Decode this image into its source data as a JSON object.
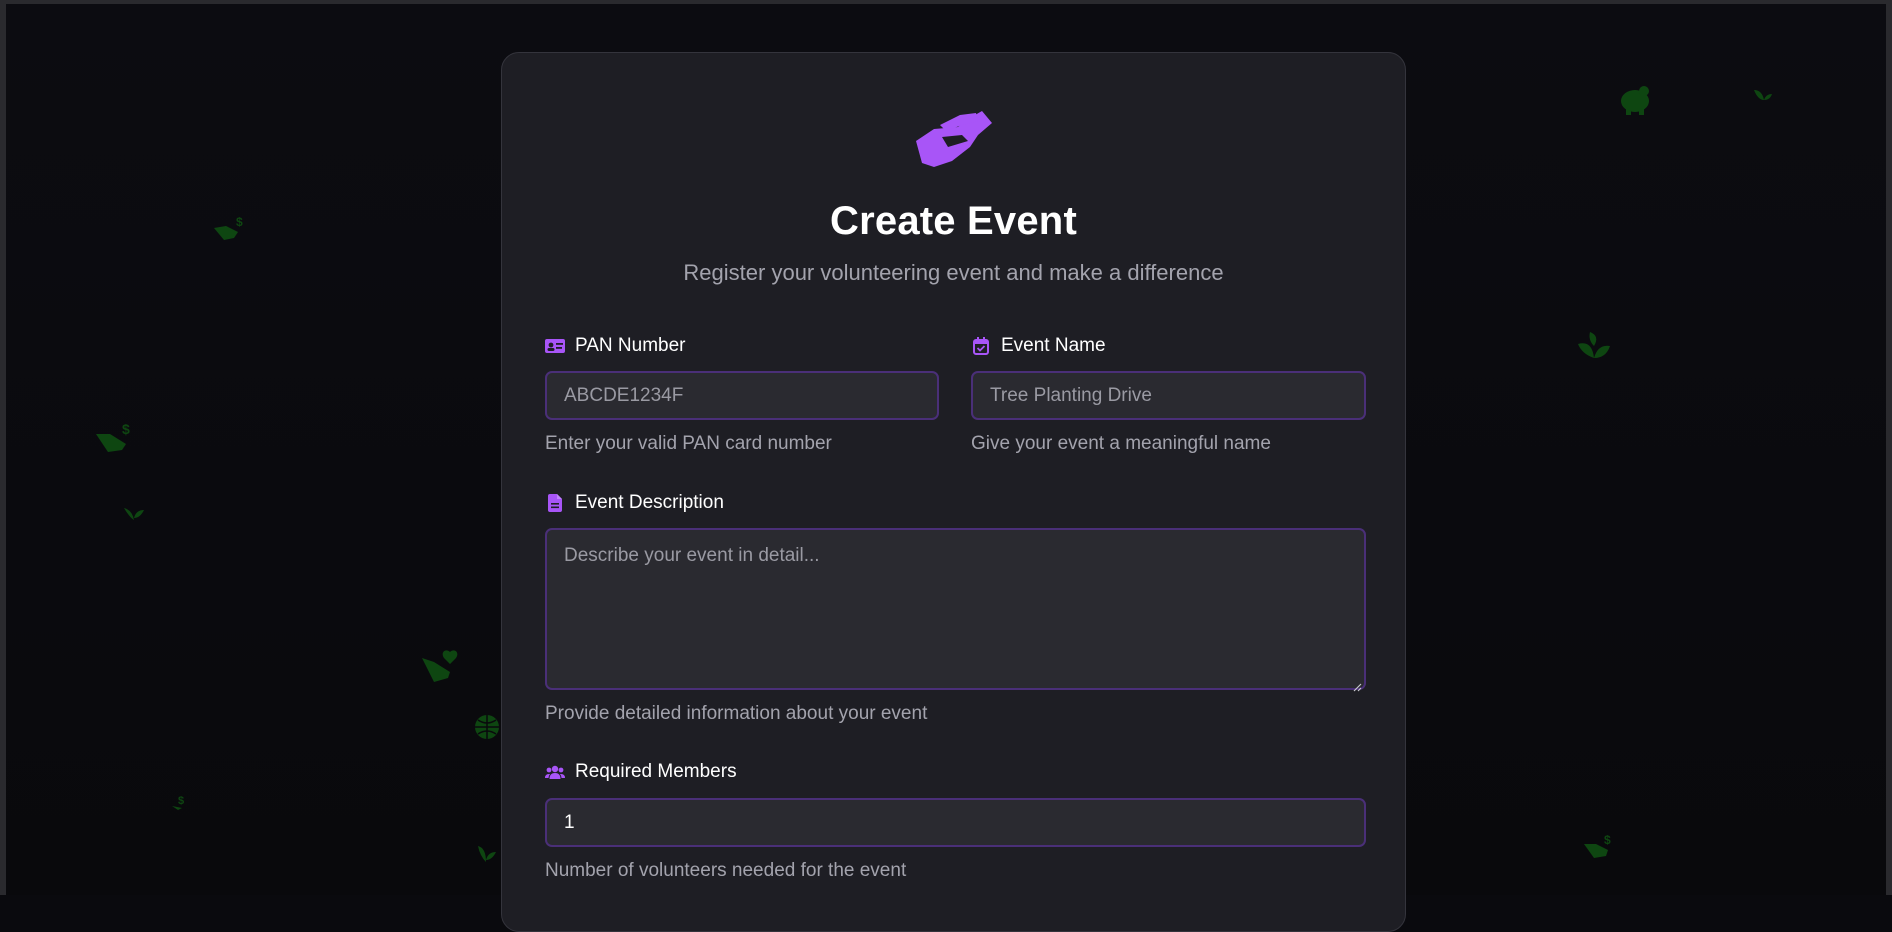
{
  "page": {
    "title": "Create Event",
    "subtitle": "Register your volunteering event and make a difference",
    "logo_icon": "handshake-icon",
    "accent_color": "#a855f7",
    "background_color": "#0a0a0e",
    "card_color": "#1e1e24",
    "deco_color": "#0f4d12"
  },
  "form": {
    "pan": {
      "label": "PAN Number",
      "icon": "id-card-icon",
      "placeholder": "ABCDE1234F",
      "hint": "Enter your valid PAN card number"
    },
    "event_name": {
      "label": "Event Name",
      "icon": "calendar-check-icon",
      "placeholder": "Tree Planting Drive",
      "hint": "Give your event a meaningful name"
    },
    "description": {
      "label": "Event Description",
      "icon": "file-text-icon",
      "placeholder": "Describe your event in detail...",
      "hint": "Provide detailed information about your event"
    },
    "members": {
      "label": "Required Members",
      "icon": "users-icon",
      "value": "1",
      "hint": "Number of volunteers needed for the event"
    }
  }
}
